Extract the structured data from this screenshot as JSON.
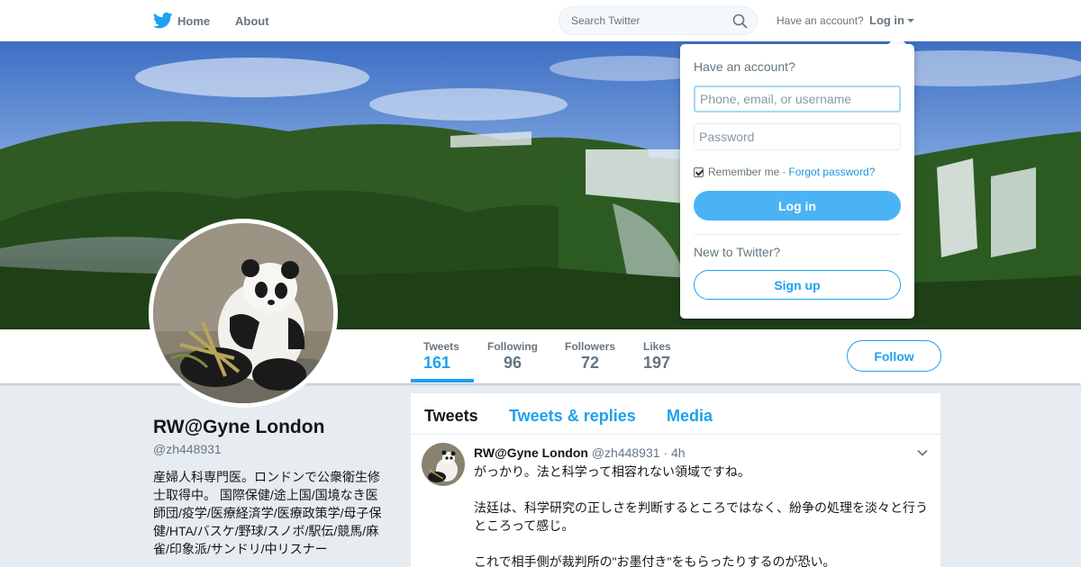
{
  "nav": {
    "home_label": "Home",
    "about_label": "About",
    "search_placeholder": "Search Twitter",
    "have_account": "Have an account?",
    "login_label": "Log in"
  },
  "colors": {
    "accent": "#1da1f2",
    "background": "#e6ecf0",
    "muted": "#66757f"
  },
  "icons": {
    "logo": "twitter-bird-icon",
    "search": "search-icon",
    "caret": "caret-down-icon",
    "tweet_menu": "chevron-down-icon"
  },
  "profile": {
    "name": "RW@Gyne London",
    "handle": "@zh448931",
    "bio": "産婦人科専門医。ロンドンで公衆衛生修士取得中。 国際保健/途上国/国境なき医師団/疫学/医療経済学/医療政策学/母子保健/HTA/バスケ/野球/スノボ/駅伝/競馬/麻雀/印象派/サンドリ/中リスナー"
  },
  "stats": [
    {
      "label": "Tweets",
      "value": "161"
    },
    {
      "label": "Following",
      "value": "96"
    },
    {
      "label": "Followers",
      "value": "72"
    },
    {
      "label": "Likes",
      "value": "197"
    }
  ],
  "follow_label": "Follow",
  "tabs": [
    {
      "label": "Tweets"
    },
    {
      "label": "Tweets & replies"
    },
    {
      "label": "Media"
    }
  ],
  "tweet": {
    "name": "RW@Gyne London",
    "handle": "@zh448931",
    "separator": "·",
    "time": "4h",
    "lines": [
      "がっかり。法と科学って相容れない領域ですね。",
      "法廷は、科学研究の正しさを判断するところではなく、紛争の処理を淡々と行うところって感じ。",
      "これで相手側が裁判所の\"お墨付き\"をもらったりするのが恐い。"
    ]
  },
  "login_dropdown": {
    "title": "Have an account?",
    "username_placeholder": "Phone, email, or username",
    "password_placeholder": "Password",
    "remember_label": "Remember me",
    "separator": "·",
    "forgot_label": "Forgot password?",
    "login_button": "Log in",
    "new_label": "New to Twitter?",
    "signup_button": "Sign up"
  }
}
